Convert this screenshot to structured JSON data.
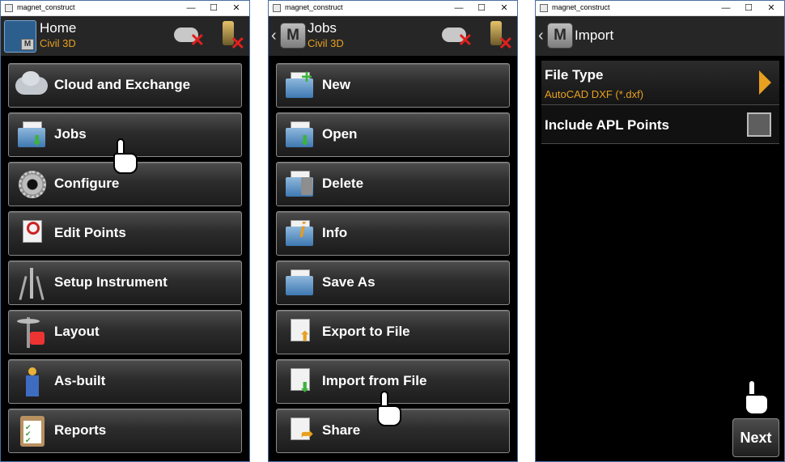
{
  "window_title": "magnet_construct",
  "controls": {
    "minimize": "—",
    "maximize": "☐",
    "close": "✕"
  },
  "home": {
    "title": "Home",
    "subtitle": "Civil 3D",
    "items": [
      {
        "label": "Cloud and Exchange",
        "icon": "cloud-icon"
      },
      {
        "label": "Jobs",
        "icon": "jobs-folder-icon"
      },
      {
        "label": "Configure",
        "icon": "gear-icon"
      },
      {
        "label": "Edit Points",
        "icon": "edit-points-icon"
      },
      {
        "label": "Setup Instrument",
        "icon": "tripod-icon"
      },
      {
        "label": "Layout",
        "icon": "layout-stakeout-icon"
      },
      {
        "label": "As-built",
        "icon": "surveyor-icon"
      },
      {
        "label": "Reports",
        "icon": "clipboard-icon"
      }
    ]
  },
  "jobs": {
    "title": "Jobs",
    "subtitle": "Civil 3D",
    "back": "‹",
    "items": [
      {
        "label": "New",
        "icon": "new-folder-icon"
      },
      {
        "label": "Open",
        "icon": "open-folder-icon"
      },
      {
        "label": "Delete",
        "icon": "delete-folder-icon"
      },
      {
        "label": "Info",
        "icon": "info-folder-icon"
      },
      {
        "label": "Save As",
        "icon": "save-as-folder-icon"
      },
      {
        "label": "Export to File",
        "icon": "export-file-icon"
      },
      {
        "label": "Import from File",
        "icon": "import-file-icon"
      },
      {
        "label": "Share",
        "icon": "share-icon"
      }
    ]
  },
  "import": {
    "title": "Import",
    "back": "‹",
    "file_type_label": "File Type",
    "file_type_value": "AutoCAD DXF (*.dxf)",
    "apl_label": "Include APL Points",
    "apl_checked": false,
    "next_label": "Next"
  },
  "logo_text": "M",
  "status": {
    "cloud": "disconnected",
    "instrument": "disconnected"
  },
  "colors": {
    "accent": "#e8a020",
    "background": "#000000",
    "error": "#e0201e"
  }
}
